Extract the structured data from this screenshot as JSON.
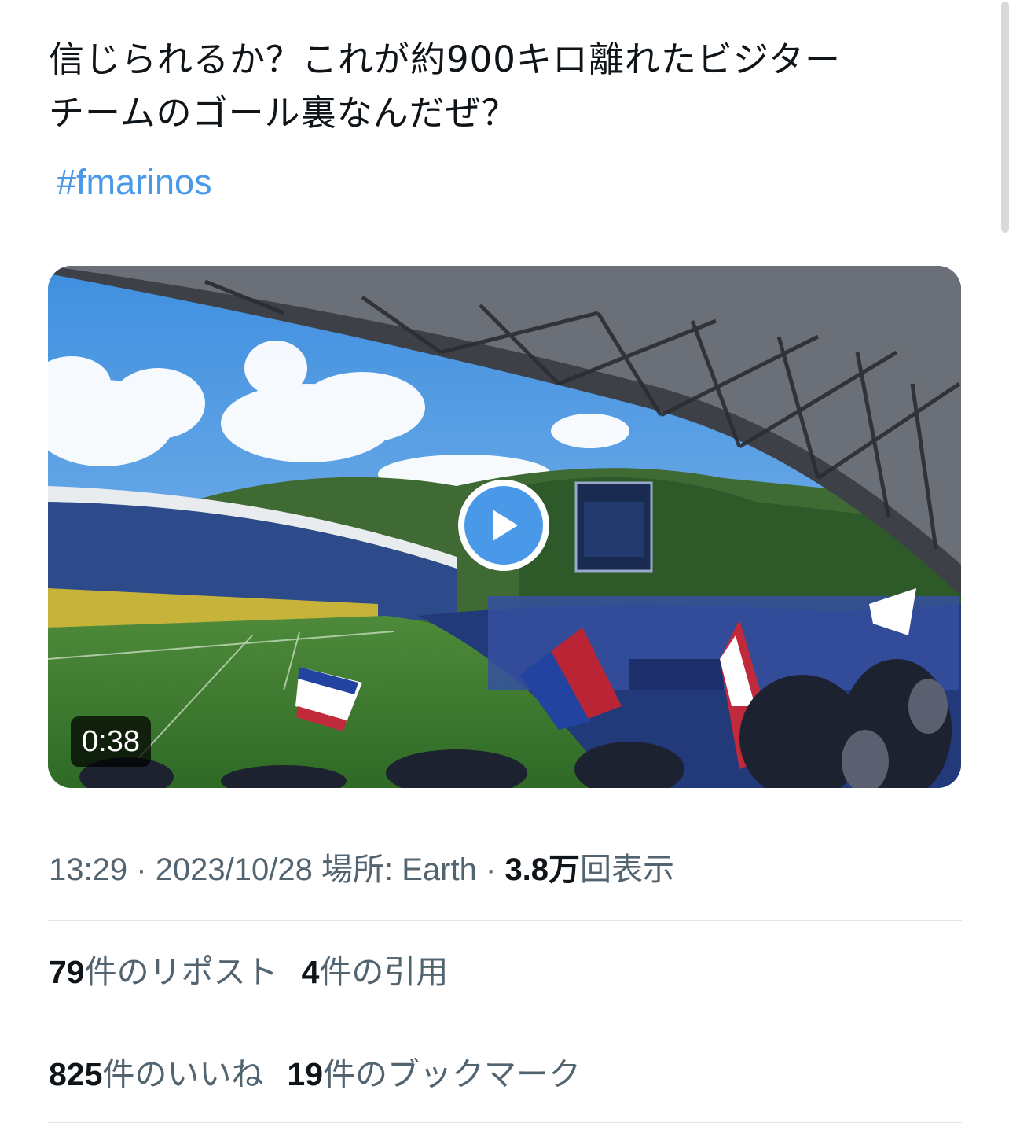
{
  "tweet": {
    "text_line1": "信じられるか？これが約900キロ離れたビジター",
    "text_line2": "チームのゴール裏なんだぜ？",
    "hashtag": "#fmarinos"
  },
  "video": {
    "duration": "0:38",
    "play_icon": "play-icon"
  },
  "meta": {
    "time": "13:29",
    "separator": "·",
    "date": "2023/10/28",
    "location_label": "場所: Earth",
    "views_count": "3.8万",
    "views_label": "回表示"
  },
  "stats": {
    "reposts_count": "79",
    "reposts_label": "件のリポスト",
    "quotes_count": "4",
    "quotes_label": "件の引用",
    "likes_count": "825",
    "likes_label": "件のいいね",
    "bookmarks_count": "19",
    "bookmarks_label": "件のブックマーク"
  },
  "colors": {
    "link": "#4a99e9",
    "secondary_text": "#536471",
    "primary_text": "#0f1419"
  }
}
